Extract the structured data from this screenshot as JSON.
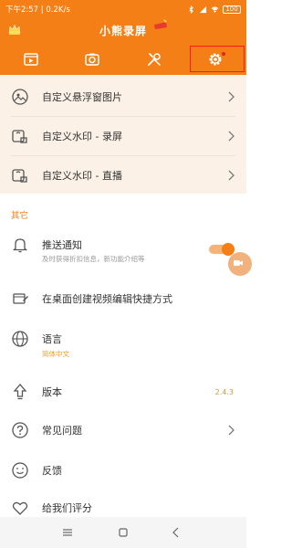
{
  "status_bar": {
    "time": "下午2:57",
    "speed": "0.2K/s",
    "battery": "100"
  },
  "app": {
    "title": "小熊录屏"
  },
  "tabs": [
    {
      "name": "video-tab",
      "icon": "film-icon"
    },
    {
      "name": "camera-tab",
      "icon": "camera-icon"
    },
    {
      "name": "tools-tab",
      "icon": "tools-icon"
    },
    {
      "name": "settings-tab",
      "icon": "gear-icon",
      "selected": true,
      "badge": true
    }
  ],
  "custom_section": {
    "items": [
      {
        "label": "自定义悬浮窗图片",
        "icon": "image-icon"
      },
      {
        "label": "自定义水印 - 录屏",
        "icon": "watermark-icon"
      },
      {
        "label": "自定义水印 - 直播",
        "icon": "watermark-icon"
      }
    ]
  },
  "other_section": {
    "header": "其它",
    "push": {
      "label": "推送通知",
      "sub": "及时获得折扣信息，新功能介绍等",
      "enabled": true
    },
    "shortcut": {
      "label": "在桌面创建视频编辑快捷方式"
    },
    "language": {
      "label": "语言",
      "value": "简体中文"
    },
    "version": {
      "label": "版本",
      "value": "2.4.3"
    },
    "faq": {
      "label": "常见问题"
    },
    "feedback": {
      "label": "反馈"
    },
    "rate": {
      "label": "给我们评分"
    }
  },
  "colors": {
    "accent": "#f37f16",
    "section_bg": "#fbf1e6",
    "highlight_border": "#ff1a1a"
  }
}
